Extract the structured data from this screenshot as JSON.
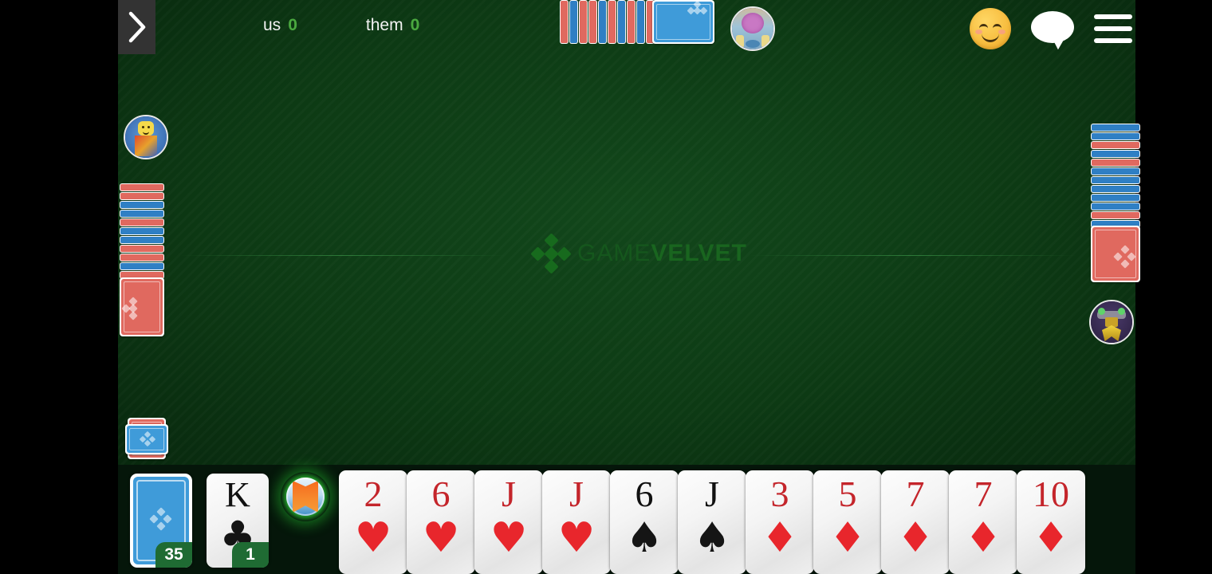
{
  "app": {
    "watermark_part1": "GAME",
    "watermark_part2": "VELVET",
    "table_color": "#0d3a14",
    "accent_green": "#4aa83f"
  },
  "topbar": {
    "back_icon": "chevron-right-icon",
    "scores": {
      "us_label": "us",
      "us_value": "0",
      "them_label": "them",
      "them_value": "0"
    },
    "emoji_button": "smiley-face-icon",
    "chat_button": "chat-bubble-icon",
    "menu_button": "hamburger-menu-icon"
  },
  "players": [
    {
      "name": "avatar-top",
      "position": "top"
    },
    {
      "name": "avatar-left",
      "position": "left"
    },
    {
      "name": "avatar-right",
      "position": "right"
    }
  ],
  "piles": {
    "top_stack_count": 11,
    "left_stack_count": 12,
    "right_stack_count": 12,
    "discard_label": "discard-pile"
  },
  "deck": {
    "icon": "card-back-blue",
    "count": "35"
  },
  "trump": {
    "rank": "K",
    "suit": "♣",
    "color": "black",
    "count": "1"
  },
  "action_button": {
    "name": "play-action-button"
  },
  "hand": {
    "cards": [
      {
        "rank": "2",
        "suit": "♥",
        "color": "red"
      },
      {
        "rank": "6",
        "suit": "♥",
        "color": "red"
      },
      {
        "rank": "J",
        "suit": "♥",
        "color": "red"
      },
      {
        "rank": "J",
        "suit": "♥",
        "color": "red"
      },
      {
        "rank": "6",
        "suit": "♠",
        "color": "black"
      },
      {
        "rank": "J",
        "suit": "♠",
        "color": "black"
      },
      {
        "rank": "3",
        "suit": "♦",
        "color": "red"
      },
      {
        "rank": "5",
        "suit": "♦",
        "color": "red"
      },
      {
        "rank": "7",
        "suit": "♦",
        "color": "red"
      },
      {
        "rank": "7",
        "suit": "♦",
        "color": "red"
      },
      {
        "rank": "10",
        "suit": "♦",
        "color": "red"
      }
    ]
  }
}
